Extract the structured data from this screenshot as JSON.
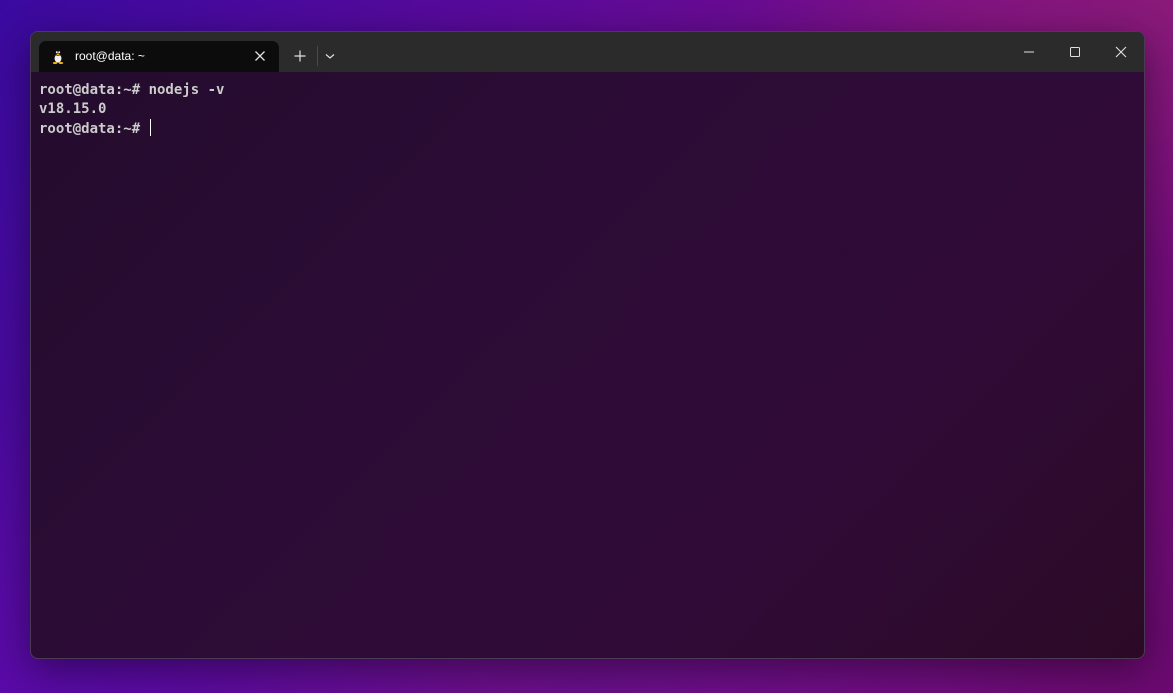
{
  "window": {
    "tab": {
      "title": "root@data: ~",
      "icon": "linux-penguin-icon"
    },
    "buttons": {
      "new_tab_icon": "plus-icon",
      "dropdown_icon": "chevron-down-icon",
      "minimize_icon": "minimize-icon",
      "maximize_icon": "maximize-icon",
      "close_icon": "close-icon"
    }
  },
  "terminal": {
    "lines": [
      "root@data:~# nodejs -v",
      "v18.15.0"
    ],
    "prompt": "root@data:~# "
  },
  "colors": {
    "terminal_text": "#cccccc",
    "titlebar": "#2b2b2b",
    "active_tab": "#0c0c0c"
  }
}
